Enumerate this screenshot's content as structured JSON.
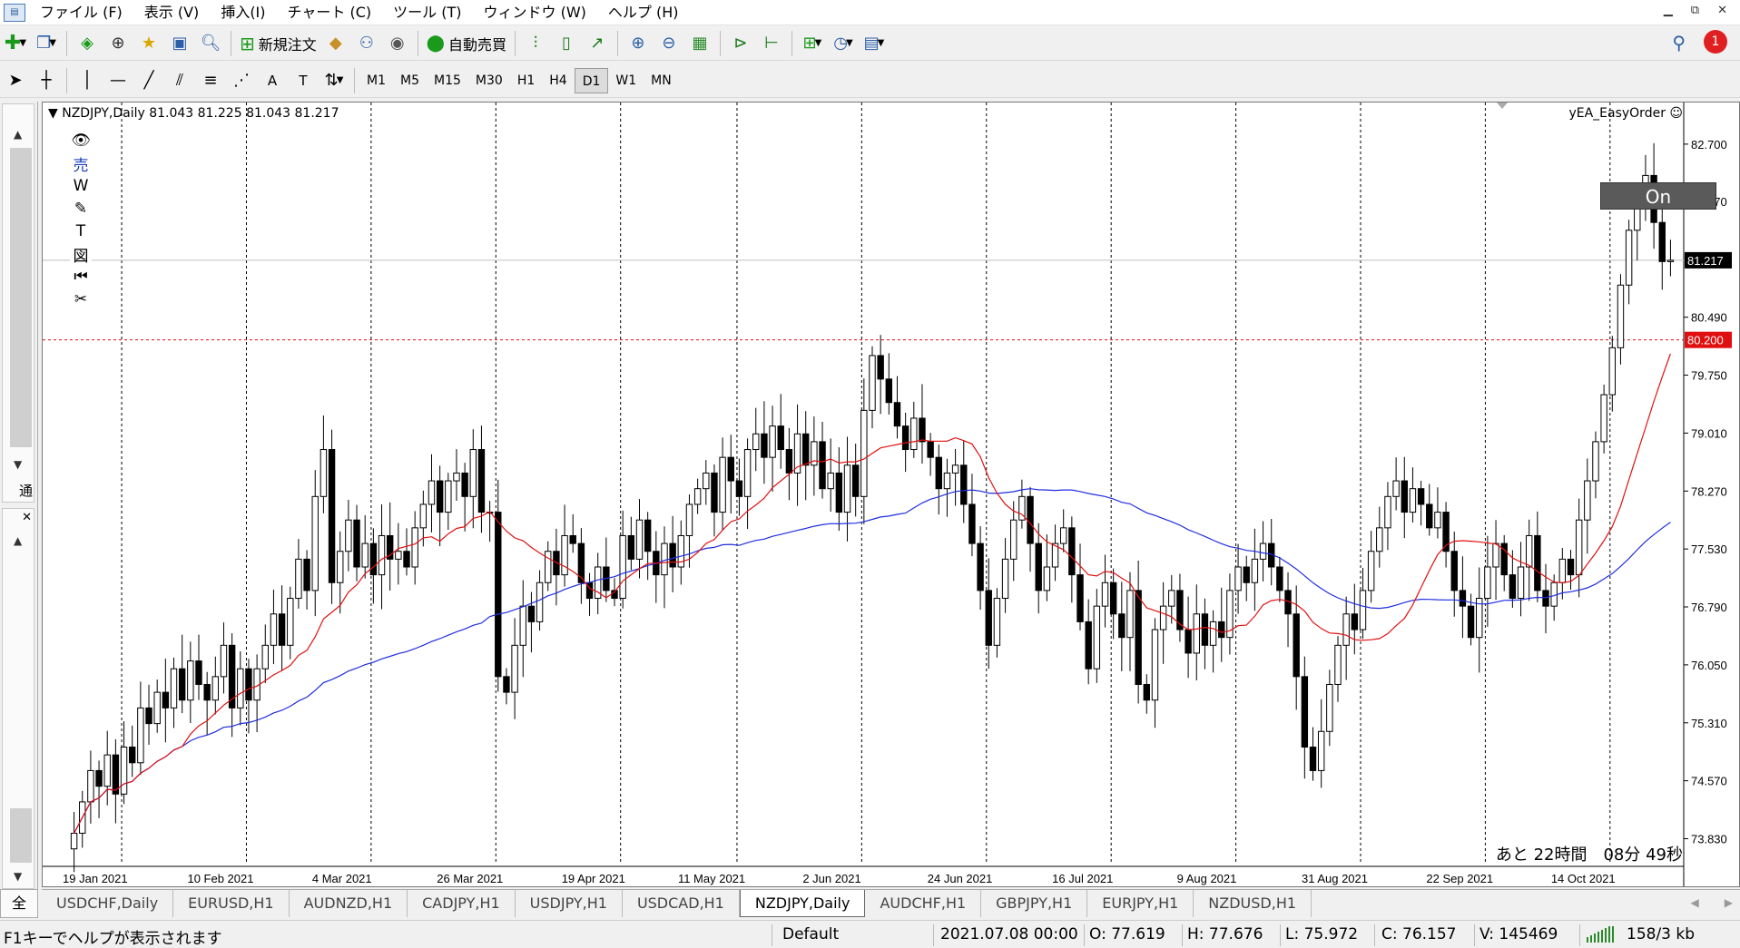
{
  "menu": {
    "items": [
      "ファイル (F)",
      "表示 (V)",
      "挿入(I)",
      "チャート (C)",
      "ツール (T)",
      "ウィンドウ (W)",
      "ヘルプ (H)"
    ],
    "window_controls": [
      "▁",
      "⧉",
      "✕"
    ]
  },
  "toolbar": {
    "new_order": "新規注文",
    "auto_trade": "自動売買",
    "notification_count": "1"
  },
  "periods": [
    "M1",
    "M5",
    "M15",
    "M30",
    "H1",
    "H4",
    "D1",
    "W1",
    "MN"
  ],
  "active_period": "D1",
  "tool_glyphs": {
    "text_tool": "A",
    "text_label_tool": "T"
  },
  "left_panel": {
    "label_top": "通",
    "label_bottom": "全"
  },
  "chart": {
    "title": "NZDJPY,Daily  81.043 81.225 81.043 81.217",
    "ea_name": "yEA_EasyOrder ☺",
    "on_button": "On",
    "countdown": "あと 22時間　08分 49秒",
    "easyorder_tools": [
      "👁",
      "売",
      "W",
      "✎",
      "T",
      "図",
      "⏮",
      "✂"
    ]
  },
  "chart_data": {
    "type": "candlestick",
    "symbol": "NZDJPY",
    "timeframe": "Daily",
    "current_price": 81.217,
    "horizontal_level": 80.2,
    "y_ticks": [
      82.7,
      81.97,
      80.49,
      79.75,
      79.01,
      78.27,
      77.53,
      76.79,
      76.05,
      75.31,
      74.57,
      73.83
    ],
    "x_labels": [
      "19 Jan 2021",
      "10 Feb 2021",
      "4 Mar 2021",
      "26 Mar 2021",
      "19 Apr 2021",
      "11 May 2021",
      "2 Jun 2021",
      "24 Jun 2021",
      "16 Jul 2021",
      "9 Aug 2021",
      "31 Aug 2021",
      "22 Sep 2021",
      "14 Oct 2021"
    ],
    "ylim": [
      73.5,
      83.0
    ],
    "closes": [
      73.9,
      74.3,
      74.7,
      74.5,
      74.9,
      74.4,
      75.0,
      74.8,
      75.5,
      75.3,
      75.7,
      75.5,
      76.0,
      75.6,
      76.1,
      75.8,
      75.6,
      75.9,
      76.3,
      75.5,
      76.0,
      75.6,
      76.0,
      76.3,
      76.7,
      76.3,
      76.9,
      77.4,
      77.0,
      78.2,
      78.8,
      77.1,
      77.5,
      77.9,
      77.3,
      77.6,
      77.2,
      77.7,
      77.4,
      77.5,
      77.3,
      77.8,
      78.1,
      78.4,
      78.0,
      78.4,
      78.5,
      78.2,
      78.8,
      78.0,
      78.0,
      75.9,
      75.7,
      76.3,
      76.8,
      76.6,
      77.1,
      77.5,
      77.2,
      77.7,
      77.6,
      77.1,
      76.9,
      77.3,
      77.0,
      76.9,
      77.7,
      77.4,
      77.9,
      77.5,
      77.2,
      77.6,
      77.3,
      77.7,
      78.1,
      78.3,
      78.5,
      78.0,
      78.7,
      78.4,
      78.2,
      78.8,
      79.0,
      78.7,
      79.1,
      78.8,
      78.5,
      79.0,
      78.6,
      78.9,
      78.3,
      78.5,
      78.0,
      78.6,
      78.2,
      79.3,
      80.0,
      79.7,
      79.4,
      79.1,
      78.8,
      79.2,
      78.9,
      78.7,
      78.3,
      78.5,
      78.6,
      78.1,
      77.6,
      77.0,
      76.3,
      76.9,
      77.4,
      77.9,
      78.2,
      77.6,
      77.0,
      77.3,
      77.6,
      77.8,
      77.2,
      76.6,
      76.0,
      76.8,
      77.1,
      76.7,
      76.4,
      77.0,
      75.8,
      75.6,
      76.5,
      76.8,
      77.0,
      76.5,
      76.2,
      76.7,
      76.3,
      76.6,
      76.4,
      77.0,
      77.3,
      77.1,
      77.4,
      77.6,
      77.3,
      77.0,
      76.7,
      75.9,
      75.0,
      74.7,
      75.2,
      75.8,
      76.3,
      76.7,
      76.5,
      77.0,
      77.5,
      77.8,
      78.2,
      78.4,
      78.0,
      78.3,
      78.1,
      77.8,
      78.0,
      77.5,
      77.0,
      76.8,
      76.4,
      76.9,
      77.3,
      77.6,
      77.2,
      76.9,
      77.3,
      77.7,
      77.0,
      76.8,
      77.1,
      77.4,
      77.2,
      77.9,
      78.4,
      78.9,
      79.5,
      80.1,
      80.9,
      81.6,
      82.0,
      82.3,
      81.7,
      81.2,
      81.217
    ],
    "ma_fast_last": 80.7,
    "ma_slow_last": 78.3
  },
  "tabs": [
    "USDCHF,Daily",
    "EURUSD,H1",
    "AUDNZD,H1",
    "CADJPY,H1",
    "USDJPY,H1",
    "USDCAD,H1",
    "NZDJPY,Daily",
    "AUDCHF,H1",
    "GBPJPY,H1",
    "EURJPY,H1",
    "NZDUSD,H1"
  ],
  "active_tab": "NZDJPY,Daily",
  "status": {
    "help": "F1キーでヘルプが表示されます",
    "profile": "Default",
    "datetime": "2021.07.08 00:00",
    "open": "O: 77.619",
    "high": "H: 77.676",
    "low": "L: 75.972",
    "close": "C: 76.157",
    "volume": "V: 145469",
    "traffic": "158/3 kb"
  },
  "colors": {
    "ma_fast": "#e01010",
    "ma_slow": "#1f2de0",
    "level_line": "#e01010",
    "price_label_bg": "#000000",
    "level_label_bg": "#e01010"
  }
}
